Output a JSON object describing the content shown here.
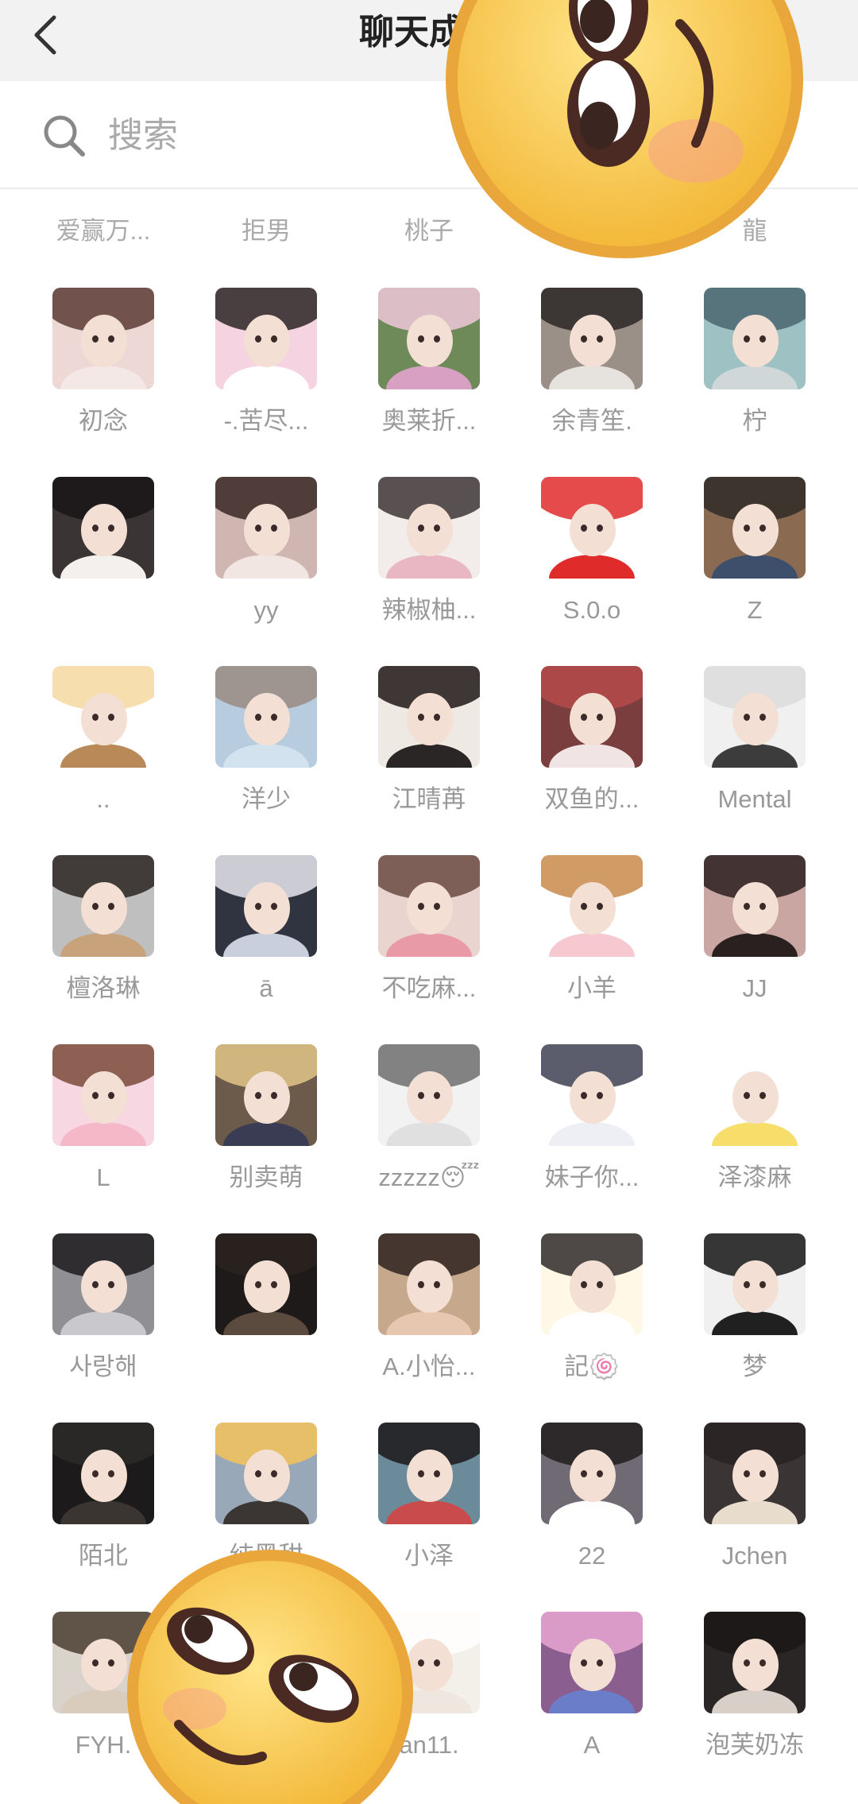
{
  "header": {
    "title": "聊天成员"
  },
  "search": {
    "placeholder": "搜索",
    "value": ""
  },
  "top_partial_row": [
    "爱赢万...",
    "拒男",
    "桃子",
    "",
    "龍"
  ],
  "members": [
    {
      "name": "初念",
      "bg": "#eed8d6",
      "hair": "#5a3b34",
      "top": "#f3e8e6"
    },
    {
      "name": "-.苦尽...",
      "bg": "#f6d3e0",
      "hair": "#2c2423",
      "top": "#ffffff"
    },
    {
      "name": "奥莱折...",
      "bg": "#6d8a58",
      "hair": "#f0c7d9",
      "top": "#d8a0c2"
    },
    {
      "name": "余青笙.",
      "bg": "#9a9088",
      "hair": "#2b2726",
      "top": "#e6e3df"
    },
    {
      "name": "柠",
      "bg": "#9ec2c4",
      "hair": "#4a6671",
      "top": "#cfd7d8"
    },
    {
      "name": "",
      "bg": "#3a3434",
      "hair": "#1a1516",
      "top": "#f4f0ee"
    },
    {
      "name": "yy",
      "bg": "#cfb6b0",
      "hair": "#3a2826",
      "top": "#f1e6e2"
    },
    {
      "name": "辣椒柚...",
      "bg": "#f2eceb",
      "hair": "#3d3536",
      "top": "#e9b7c3"
    },
    {
      "name": "S.0.o",
      "bg": "#ffffff",
      "hair": "#e02b2b",
      "top": "#e02b2b"
    },
    {
      "name": "Z",
      "bg": "#8a6b52",
      "hair": "#2f2a27",
      "top": "#3e4f6b"
    },
    {
      "name": "..",
      "bg": "#ffffff",
      "hair": "#f5d8a0",
      "top": "#b98957"
    },
    {
      "name": "洋少",
      "bg": "#b7ccdf",
      "hair": "#9a8b84",
      "top": "#d2e2ee"
    },
    {
      "name": "江晴苒",
      "bg": "#efe9e4",
      "hair": "#1e1817",
      "top": "#2a2626"
    },
    {
      "name": "双鱼的...",
      "bg": "#7a3e3e",
      "hair": "#b54a49",
      "top": "#f0e4e4"
    },
    {
      "name": "Mental",
      "bg": "#f0f0f0",
      "hair": "#dcdcdc",
      "top": "#3c3c3c"
    },
    {
      "name": "檀洛琳",
      "bg": "#bfbfbf",
      "hair": "#2a2321",
      "top": "#c7a27a"
    },
    {
      "name": "ā",
      "bg": "#2f3440",
      "hair": "#e6e8ee",
      "top": "#c9cfdc"
    },
    {
      "name": "不吃麻...",
      "bg": "#e9d4d0",
      "hair": "#6b4a42",
      "top": "#e89aa6"
    },
    {
      "name": "小羊",
      "bg": "#ffffff",
      "hair": "#c98a4a",
      "top": "#f6c8d0"
    },
    {
      "name": "JJ",
      "bg": "#caa6a2",
      "hair": "#2b2020",
      "top": "#2b2020"
    },
    {
      "name": "L",
      "bg": "#f7d8e2",
      "hair": "#7a4b3a",
      "top": "#f4b8c8"
    },
    {
      "name": "别卖萌",
      "bg": "#6c5a4a",
      "hair": "#e3c588",
      "top": "#3a3c54"
    },
    {
      "name": "zzzzz😴",
      "bg": "#f2f2f2",
      "hair": "#6f6f6f",
      "top": "#e0e0e0"
    },
    {
      "name": "妹子你...",
      "bg": "#ffffff",
      "hair": "#3e4152",
      "top": "#eeeef5"
    },
    {
      "name": "泽漆麻",
      "bg": "#ffffff",
      "hair": "#ffffff",
      "top": "#f7dd6a"
    },
    {
      "name": "사랑해",
      "bg": "#8f8f94",
      "hair": "#1e1c1e",
      "top": "#c9c9cd"
    },
    {
      "name": "",
      "bg": "#1e1a1a",
      "hair": "#2b2320",
      "top": "#5b4a3e"
    },
    {
      "name": "A.小怡...",
      "bg": "#c6a98c",
      "hair": "#2e2320",
      "top": "#e8c7b0"
    },
    {
      "name": "記🍥",
      "bg": "#fff8e6",
      "hair": "#2f2a2a",
      "top": "#ffffff"
    },
    {
      "name": "梦",
      "bg": "#f0f0f0",
      "hair": "#151515",
      "top": "#202020"
    },
    {
      "name": "陌北",
      "bg": "#1c1a1a",
      "hair": "#2d2a2a",
      "top": "#3a3530"
    },
    {
      "name": "纯黑甜",
      "bg": "#99a8b8",
      "hair": "#f5c35a",
      "top": "#3b3634"
    },
    {
      "name": "小泽",
      "bg": "#6c8b9a",
      "hair": "#1b1819",
      "top": "#c94b4b"
    },
    {
      "name": "22",
      "bg": "#6f6a73",
      "hair": "#221d1d",
      "top": "#ffffff"
    },
    {
      "name": "Jchen",
      "bg": "#3a3434",
      "hair": "#2a2323",
      "top": "#e8dccd"
    },
    {
      "name": "FYH.",
      "bg": "#d9d3cb",
      "hair": "#4a3d33",
      "top": "#d9ccbc"
    },
    {
      "name": "",
      "bg": "#e8e2d6",
      "hair": "#3d3430",
      "top": "#e9e2d6"
    },
    {
      "name": "an11.",
      "bg": "#f3efe9",
      "hair": "#ffffff",
      "top": "#f0e6e0"
    },
    {
      "name": "A",
      "bg": "#8a5f8f",
      "hair": "#e8a6d4",
      "top": "#6b7cc9"
    },
    {
      "name": "泡芙奶冻",
      "bg": "#2a2626",
      "hair": "#1c1818",
      "top": "#d8cfc9"
    }
  ],
  "colors": {
    "header_bg": "#f2f2f2",
    "name_text": "#999999",
    "emoji_yellow": "#f6c64a",
    "emoji_rim": "#e8a73a"
  },
  "icons": {
    "back": "chevron-left-icon",
    "search": "search-icon"
  },
  "overlays": [
    "emoji-sticker-top",
    "emoji-sticker-bottom"
  ]
}
